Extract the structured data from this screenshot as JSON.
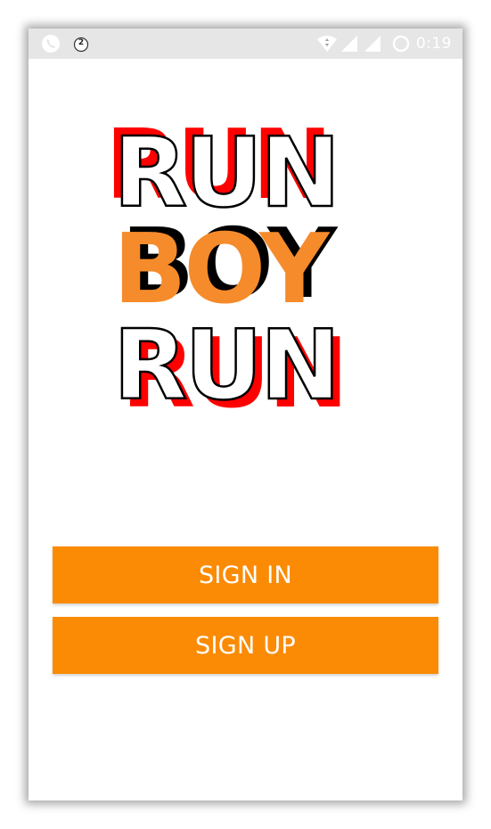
{
  "status_bar": {
    "time": "0:19",
    "notification_count": "2",
    "icons": [
      "phone-icon",
      "notification-badge-icon",
      "wifi-icon",
      "signal-icon",
      "signal-icon",
      "loading-icon"
    ]
  },
  "logo": {
    "lines": [
      "RUN",
      "BOY",
      "RUN"
    ],
    "colors": {
      "fill_white": "#ffffff",
      "fill_orange": "#f68b2b",
      "shadow_red": "#ff0000",
      "shadow_black": "#000000"
    }
  },
  "buttons": {
    "sign_in": "SIGN IN",
    "sign_up": "SIGN UP",
    "color": "#fb8b05"
  }
}
